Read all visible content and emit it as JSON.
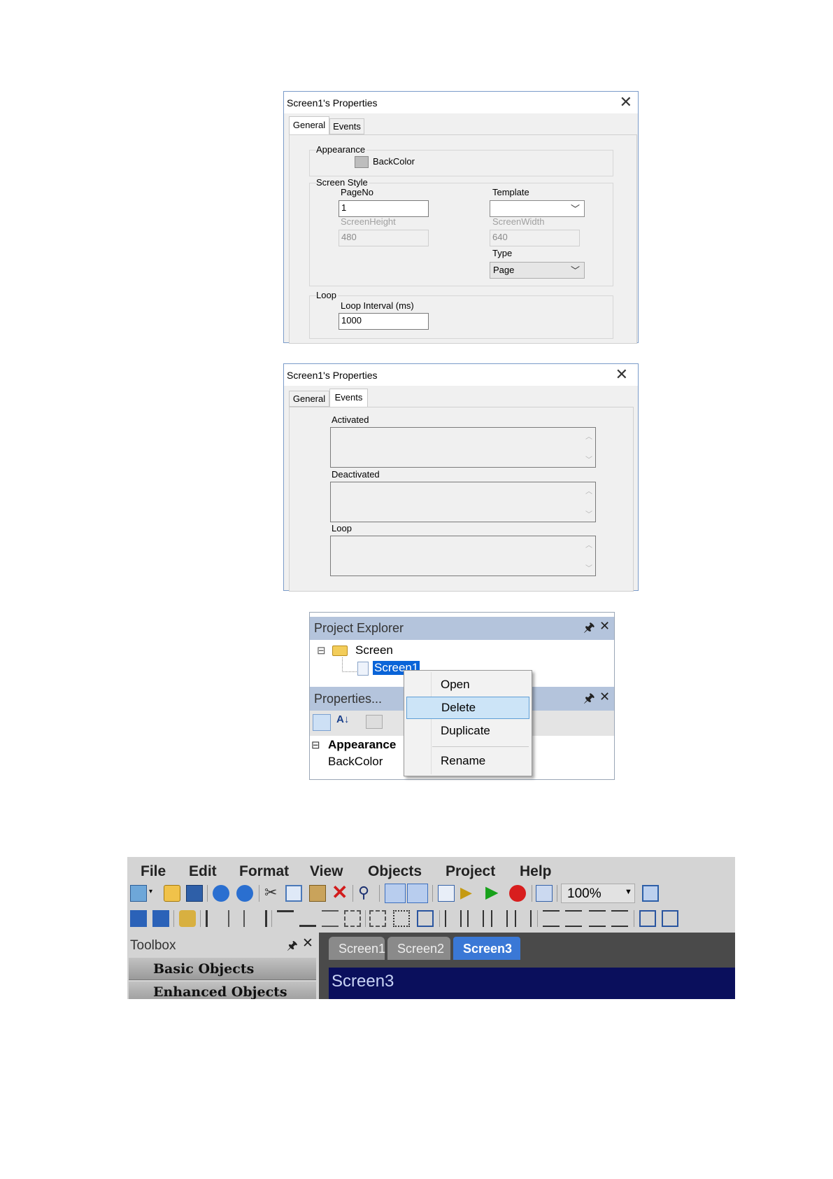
{
  "dialog1": {
    "title": "Screen1's Properties",
    "close": "✕",
    "tabs": [
      "General",
      "Events"
    ],
    "appearance": {
      "label": "Appearance",
      "backcolor": "BackColor"
    },
    "screen_style": {
      "label": "Screen Style",
      "pageno_label": "PageNo",
      "pageno_value": "1",
      "template_label": "Template",
      "template_value": "",
      "screenheight_label": "ScreenHeight",
      "screenheight_value": "480",
      "screenwidth_label": "ScreenWidth",
      "screenwidth_value": "640",
      "type_label": "Type",
      "type_value": "Page"
    },
    "loop": {
      "label": "Loop",
      "interval_label": "Loop Interval (ms)",
      "interval_value": "1000"
    }
  },
  "dialog2": {
    "title": "Screen1's Properties",
    "close": "✕",
    "tabs": [
      "General",
      "Events"
    ],
    "activated": "Activated",
    "deactivated": "Deactivated",
    "loop": "Loop"
  },
  "project_explorer": {
    "title": "Project Explorer",
    "tree": {
      "root": "Screen",
      "child": "Screen1",
      "expander": "⊟"
    },
    "properties_title": "Properties...",
    "appearance": "Appearance",
    "backcolor": "BackColor",
    "context_menu": [
      "Open",
      "Delete",
      "Duplicate",
      "Rename"
    ],
    "selected_item": "Delete"
  },
  "app": {
    "menu": [
      "File",
      "Edit",
      "Format",
      "View",
      "Objects",
      "Project",
      "Help"
    ],
    "zoom": "100%",
    "toolbox_title": "Toolbox",
    "toolbox_items": [
      "Basic Objects",
      "Enhanced Objects"
    ],
    "tabs": [
      "Screen1",
      "Screen2",
      "Screen3"
    ],
    "active_tab": "Screen3",
    "canvas_title": "Screen3"
  },
  "colors": {
    "tab_active": "#3a78d6",
    "canvas": "#0a0f5c",
    "selection": "#0a64d8",
    "panel_header": "#b4c4dc"
  }
}
